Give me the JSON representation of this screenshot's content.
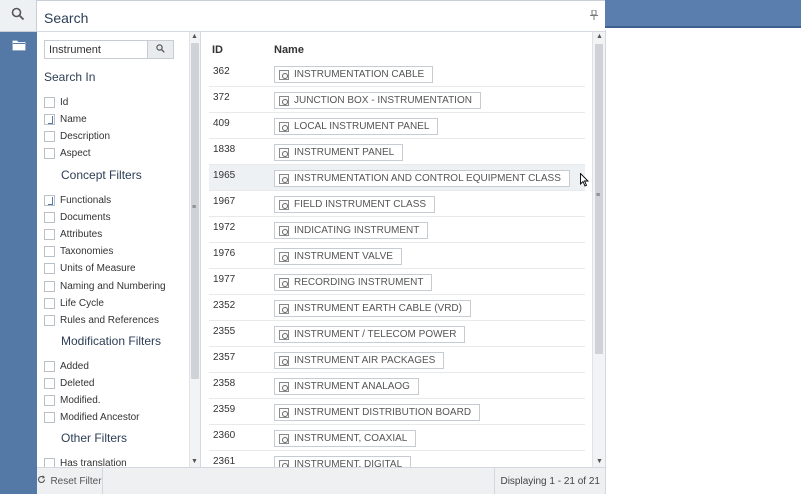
{
  "header": {
    "title": "Search"
  },
  "filter": {
    "search_value": "Instrument",
    "search_in_title": "Search In",
    "search_in": [
      {
        "label": "Id",
        "checked": false
      },
      {
        "label": "Name",
        "checked": true
      },
      {
        "label": "Description",
        "checked": false
      },
      {
        "label": "Aspect",
        "checked": false
      }
    ],
    "concept_title": "Concept Filters",
    "concept": [
      {
        "label": "Functionals",
        "checked": true
      },
      {
        "label": "Documents",
        "checked": false
      },
      {
        "label": "Attributes",
        "checked": false
      },
      {
        "label": "Taxonomies",
        "checked": false
      },
      {
        "label": "Units of Measure",
        "checked": false
      },
      {
        "label": "Naming and Numbering",
        "checked": false
      },
      {
        "label": "Life Cycle",
        "checked": false
      },
      {
        "label": "Rules and References",
        "checked": false
      }
    ],
    "modification_title": "Modification Filters",
    "modification": [
      {
        "label": "Added",
        "checked": false
      },
      {
        "label": "Deleted",
        "checked": false
      },
      {
        "label": "Modified.",
        "checked": false
      },
      {
        "label": "Modified Ancestor",
        "checked": false
      }
    ],
    "other_title": "Other Filters",
    "other": [
      {
        "label": "Has translation",
        "checked": false
      }
    ]
  },
  "grid": {
    "col_id": "ID",
    "col_name": "Name",
    "rows": [
      {
        "id": "362",
        "name": "INSTRUMENTATION CABLE"
      },
      {
        "id": "372",
        "name": "JUNCTION BOX - INSTRUMENTATION"
      },
      {
        "id": "409",
        "name": "LOCAL INSTRUMENT PANEL"
      },
      {
        "id": "1838",
        "name": "INSTRUMENT PANEL"
      },
      {
        "id": "1965",
        "name": "INSTRUMENTATION AND CONTROL EQUIPMENT CLASS"
      },
      {
        "id": "1967",
        "name": "FIELD INSTRUMENT CLASS"
      },
      {
        "id": "1972",
        "name": "INDICATING INSTRUMENT"
      },
      {
        "id": "1976",
        "name": "INSTRUMENT VALVE"
      },
      {
        "id": "1977",
        "name": "RECORDING INSTRUMENT"
      },
      {
        "id": "2352",
        "name": "INSTRUMENT EARTH CABLE (VRD)"
      },
      {
        "id": "2355",
        "name": "INSTRUMENT / TELECOM POWER"
      },
      {
        "id": "2357",
        "name": "INSTRUMENT AIR PACKAGES"
      },
      {
        "id": "2358",
        "name": "INSTRUMENT ANALAOG"
      },
      {
        "id": "2359",
        "name": "INSTRUMENT DISTRIBUTION BOARD"
      },
      {
        "id": "2360",
        "name": "INSTRUMENT, COAXIAL"
      },
      {
        "id": "2361",
        "name": "INSTRUMENT, DIGITAL"
      }
    ]
  },
  "footer": {
    "reset_label": "Reset Filter",
    "display_info": "Displaying 1 - 21 of 21"
  },
  "colors": {
    "rail": "#5479a6",
    "top_strip": "#5a7fae"
  },
  "icons": {
    "search": "search-icon",
    "folder": "folder-icon",
    "pin": "pin-icon",
    "reset": "reset-icon",
    "concept": "concept-icon"
  }
}
